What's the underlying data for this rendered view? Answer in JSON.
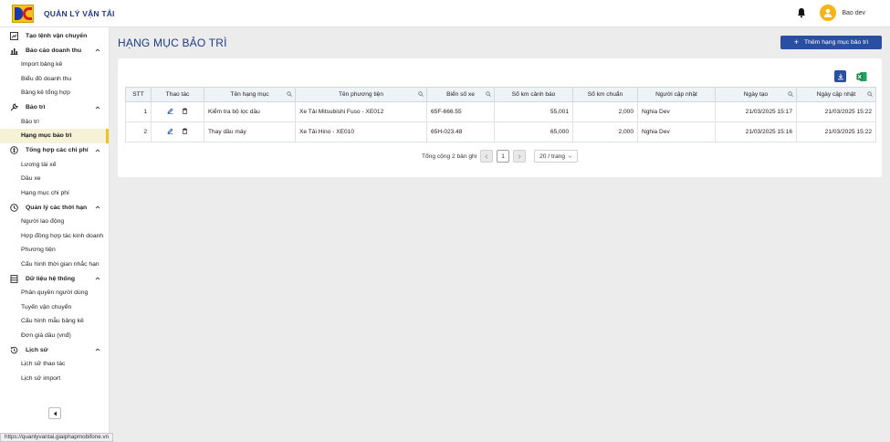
{
  "header": {
    "app_title": "QUẢN LÝ VẬN TẢI",
    "username": "Bao dev"
  },
  "sidebar": {
    "groups": [
      {
        "label": "Tạo lệnh vận chuyển",
        "icon": "chart-box-icon",
        "items": []
      },
      {
        "label": "Báo cáo doanh thu",
        "icon": "bar-chart-icon",
        "items": [
          "Import bảng kê",
          "Biểu đồ doanh thu",
          "Bảng kê tổng hợp"
        ]
      },
      {
        "label": "Bảo trì",
        "icon": "wrench-icon",
        "items": [
          "Bảo trì",
          "Hạng mục bảo trì"
        ]
      },
      {
        "label": "Tổng hợp các chi phí",
        "icon": "cost-icon",
        "items": [
          "Lương tài xế",
          "Dầu xe",
          "Hạng mục chi phí"
        ]
      },
      {
        "label": "Quản lý các thời hạn",
        "icon": "clock-icon",
        "items": [
          "Người lao động",
          "Hợp đồng hợp tác kinh doanh",
          "Phương tiện",
          "Cấu hình thời gian nhắc hạn"
        ]
      },
      {
        "label": "Dữ liệu hệ thống",
        "icon": "database-icon",
        "items": [
          "Phân quyền người dùng",
          "Tuyến vận chuyển",
          "Cấu hình mẫu bảng kê",
          "Đơn giá dầu (vnđ)"
        ]
      },
      {
        "label": "Lịch sử",
        "icon": "history-icon",
        "items": [
          "Lịch sử thao tác",
          "Lịch sử import"
        ]
      }
    ],
    "active_item": "Hạng mục bảo trì"
  },
  "status_url": "https://quanlyvantai.giaiphapmobifone.vn",
  "page": {
    "title": "HẠNG MỤC BẢO TRÌ",
    "add_button": "Thêm hạng mục bảo trì"
  },
  "table": {
    "columns": [
      "STT",
      "Thao tác",
      "Tên hạng mục",
      "Tên phương tiện",
      "Biển số xe",
      "Số km cảnh báo",
      "Số km chuẩn",
      "Người cập nhật",
      "Ngày tạo",
      "Ngày cập nhật"
    ],
    "rows": [
      [
        "1",
        "",
        "Kiểm tra bộ lọc dầu",
        "Xe Tải Mitsubishi Fuso - XE012",
        "65F-666.55",
        "55,001",
        "2,000",
        "Nghia Dev",
        "21/03/2025 15:17",
        "21/03/2025 15:22"
      ],
      [
        "2",
        "",
        "Thay dầu máy",
        "Xe Tải Hino - XE010",
        "65H-023.48",
        "65,000",
        "2,000",
        "Nghia Dev",
        "21/03/2025 15:16",
        "21/03/2025 15:22"
      ]
    ]
  },
  "pagination": {
    "total_text": "Tổng cộng 2 bản ghi",
    "current_page": "1",
    "page_size": "20 / trang"
  },
  "colors": {
    "primary": "#2a4ea2",
    "title": "#1e3a8a",
    "active_bg": "#f6f2d8",
    "active_bar": "#f0c419"
  }
}
